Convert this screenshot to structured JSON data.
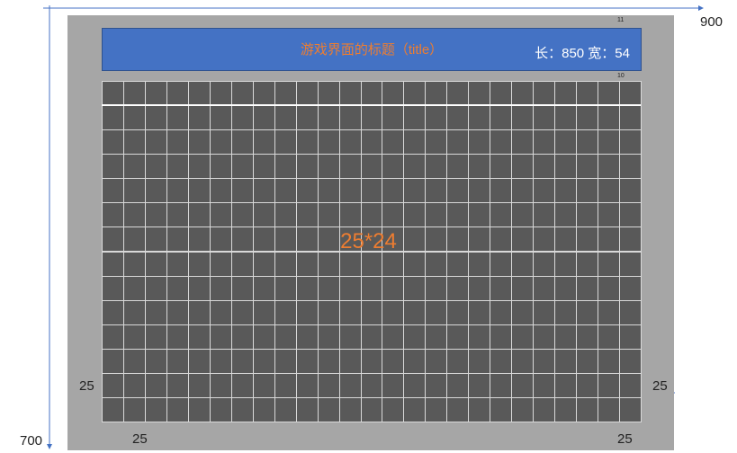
{
  "title_bar": {
    "title": "游戏界面的标题（title）",
    "size": "长：850 宽：54"
  },
  "grid": {
    "label": "25*24",
    "columns": 25,
    "rows": 14
  },
  "dimensions": {
    "width_total": "900",
    "height_total": "700",
    "margin_left": "25",
    "margin_right": "25",
    "margin_bottom_left": "25",
    "margin_bottom_right": "25",
    "gap_top": "11",
    "gap_below_title": "10"
  },
  "colors": {
    "frame": "#a6a6a6",
    "title_bg": "#4472c4",
    "title_text": "#ed7d31",
    "grid_bg": "#595959",
    "grid_line": "#d9d9d9",
    "axis": "#4472c4"
  }
}
